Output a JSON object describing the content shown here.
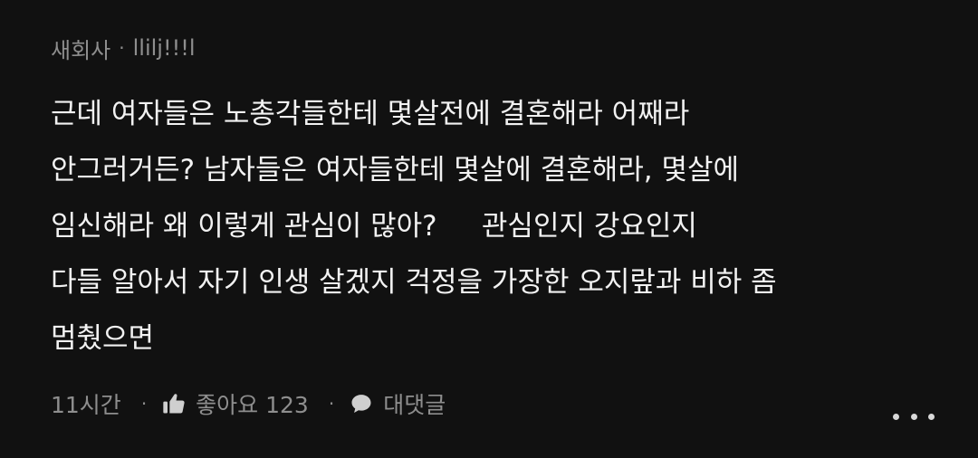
{
  "comment": {
    "nickname": "새회사",
    "separator": "·",
    "user_id": "llilj!!!l",
    "text_lines": [
      "근데 여자들은 노총각들한테 몇살전에 결혼해라 어째라",
      "안그러거든? 남자들은 여자들한테 몇살에 결혼해라, 몇살에",
      "임신해라 왜 이렇게 관심이 많아?     관심인지 강요인지",
      "다들 알아서 자기 인생 살겠지 걱정을 가장한 오지랖과 비하 좀",
      "멈췄으면"
    ],
    "time": "11시간",
    "like_label": "좋아요 123",
    "reply_label": "대댓글",
    "more_icon": "more-dots-icon",
    "like_icon": "thumbs-up-icon",
    "reply_icon": "speech-bubble-icon"
  },
  "colors": {
    "background": "#111111",
    "text": "#f2f2f2",
    "meta": "#8e8e8e"
  }
}
